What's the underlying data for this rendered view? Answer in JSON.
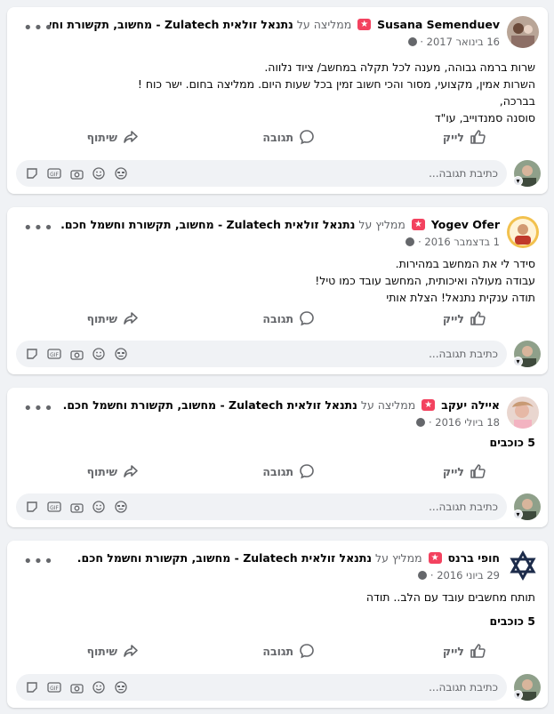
{
  "common": {
    "like": "לייק",
    "comment": "תגובה",
    "share": "שיתוף",
    "write_comment": "כתיבת תגובה..."
  },
  "reviews": [
    {
      "name": "Susana Semenduev",
      "verb": "ממליצה על",
      "page": "נתנאל זולאית Zulatech - מחשוב, תקשורת וחשמל חכם.",
      "date": "16 בינואר 2017 ·",
      "lines": [
        "שרות ברמה גבוהה, מענה לכל תקלה במחשב/ ציוד נלווה.",
        "השרות אמין, מקצועי, מסור והכי חשוב זמין בכל שעות היום. ממליצה בחום. ישר כוח !",
        "בברכה,",
        "סוסנה סמנדוייב, עו\"ד"
      ],
      "rating": ""
    },
    {
      "name": "Yogev Ofer",
      "verb": "ממליץ על",
      "page": "נתנאל זולאית Zulatech - מחשוב, תקשורת וחשמל חכם.",
      "date": "1 בדצמבר 2016 ·",
      "lines": [
        "סידר לי את המחשב במהירות.",
        "עבודה מעולה ואיכותית, המחשב עובד כמו טיל!",
        "תודה ענקית נתנאל! הצלת אותי"
      ],
      "rating": ""
    },
    {
      "name": "איילה יעקב",
      "verb": "ממליצה על",
      "page": "נתנאל זולאית Zulatech - מחשוב, תקשורת וחשמל חכם.",
      "date": "18 ביולי 2016 ·",
      "lines": [],
      "rating": "5 כוכבים"
    },
    {
      "name": "חופי ברנס",
      "verb": "ממליץ על",
      "page": "נתנאל זולאית Zulatech - מחשוב, תקשורת וחשמל חכם.",
      "date": "29 ביוני 2016 ·",
      "lines": [
        "תותח מחשבים עובד עם הלב.. תודה"
      ],
      "rating": "5 כוכבים"
    }
  ],
  "colors": {
    "badge": "#f3425f",
    "secondary_text": "#65676b",
    "background": "#f0f2f5"
  }
}
